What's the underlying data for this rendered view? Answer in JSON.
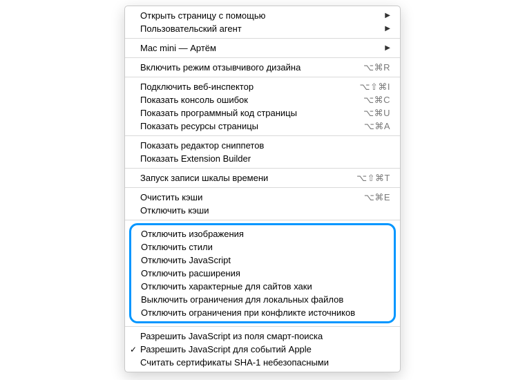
{
  "group1": [
    {
      "label": "Открыть страницу с помощью",
      "arrow": true
    },
    {
      "label": "Пользовательский агент",
      "arrow": true
    }
  ],
  "group2": [
    {
      "label": "Mac mini — Артём",
      "arrow": true
    }
  ],
  "group3": [
    {
      "label": "Включить режим отзывчивого дизайна",
      "shortcut": "⌥⌘R"
    }
  ],
  "group4": [
    {
      "label": "Подключить веб-инспектор",
      "shortcut": "⌥⇧⌘I"
    },
    {
      "label": "Показать консоль ошибок",
      "shortcut": "⌥⌘C"
    },
    {
      "label": "Показать программный код страницы",
      "shortcut": "⌥⌘U"
    },
    {
      "label": "Показать ресурсы страницы",
      "shortcut": "⌥⌘A"
    }
  ],
  "group5": [
    {
      "label": "Показать редактор сниппетов"
    },
    {
      "label": "Показать Extension Builder"
    }
  ],
  "group6": [
    {
      "label": "Запуск записи шкалы времени",
      "shortcut": "⌥⇧⌘T"
    }
  ],
  "group7": [
    {
      "label": "Очистить кэши",
      "shortcut": "⌥⌘E"
    },
    {
      "label": "Отключить кэши"
    }
  ],
  "group8": [
    {
      "label": "Отключить изображения"
    },
    {
      "label": "Отключить стили"
    },
    {
      "label": "Отключить JavaScript"
    },
    {
      "label": "Отключить расширения"
    },
    {
      "label": "Отключить характерные для сайтов хаки"
    },
    {
      "label": "Выключить ограничения для локальных файлов"
    },
    {
      "label": "Отключить ограничения при конфликте источников"
    }
  ],
  "group9": [
    {
      "label": "Разрешить JavaScript из поля смарт-поиска"
    },
    {
      "label": "Разрешить JavaScript для событий Apple",
      "checked": true
    },
    {
      "label": "Считать сертификаты SHA-1 небезопасными"
    }
  ]
}
